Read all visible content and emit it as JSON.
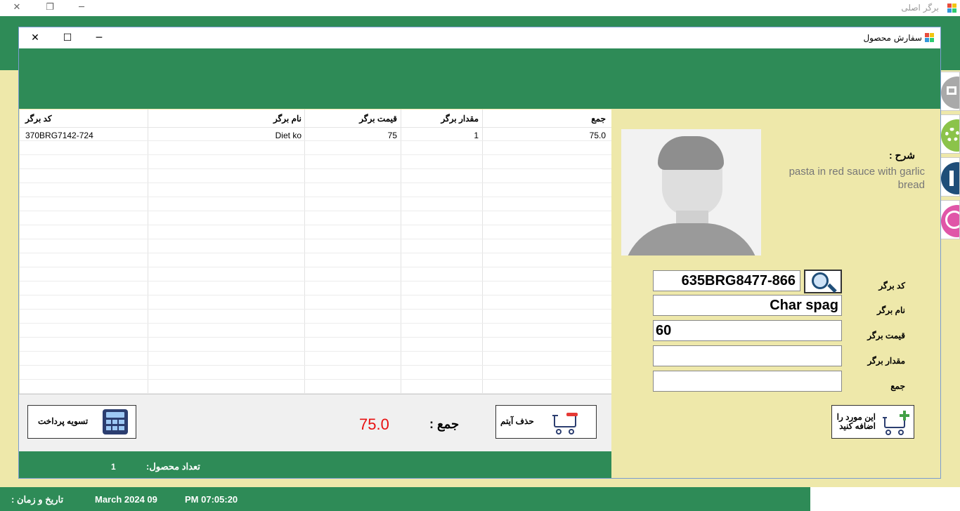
{
  "outer_window": {
    "title": "برگر اصلی"
  },
  "child_window": {
    "title": "سفارش محصول"
  },
  "grid": {
    "columns": [
      "کد برگر",
      "نام برگر",
      "قیمت برگر",
      "مقدار برگر",
      "جمع"
    ],
    "rows": [
      {
        "code": "370BRG7142-724",
        "name": "Diet ko",
        "price": "75",
        "qty": "1",
        "total": "75.0"
      }
    ]
  },
  "summary": {
    "total_label": "جمع :",
    "total_value": "75.0",
    "delete_label": "حذف آیتم",
    "pay_label": "تسویه پرداخت",
    "count_label": "تعداد محصول:",
    "count_value": "1"
  },
  "details": {
    "desc_label": "شرح :",
    "desc_text": "pasta in red sauce with garlic bread",
    "code_label": "کد برگر",
    "code_value": "635BRG8477-866",
    "name_label": "نام برگر",
    "name_value": "Char spag",
    "price_label": "قیمت برگر",
    "price_value": "60",
    "qty_label": "مقدار برگر",
    "qty_value": "",
    "total_label": "جمع",
    "total_value": "",
    "add_label_1": "این مورد را",
    "add_label_2": "اضافه کنید"
  },
  "statusbar": {
    "datetime_label": "تاریخ و زمان :",
    "date": "March 2024 09",
    "time": "PM 07:05:20"
  },
  "colors": {
    "green": "#2e8b57",
    "khaki": "#eee8aa",
    "total_red": "#e81010"
  }
}
